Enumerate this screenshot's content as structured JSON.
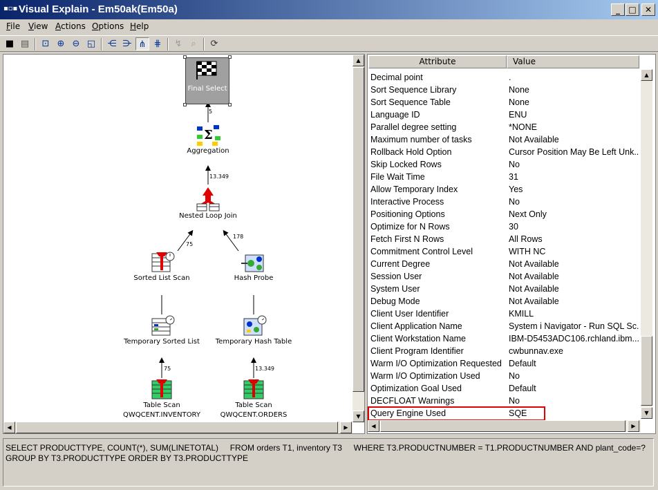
{
  "window": {
    "title": "Visual Explain - Em50ak(Em50a)",
    "icon": "graph-app-icon"
  },
  "menu": [
    {
      "key": "F",
      "rest": "ile"
    },
    {
      "key": "V",
      "rest": "iew"
    },
    {
      "key": "A",
      "rest": "ctions"
    },
    {
      "key": "O",
      "rest": "ptions"
    },
    {
      "key": "H",
      "rest": "elp"
    }
  ],
  "graph": {
    "nodes": {
      "final_select": "Final Select",
      "aggregation": "Aggregation",
      "nested_loop_join": "Nested Loop Join",
      "sorted_list_scan": "Sorted List Scan",
      "hash_probe": "Hash Probe",
      "temporary_sorted_list": "Temporary Sorted List",
      "temporary_hash_table": "Temporary Hash Table",
      "table_scan_inventory": "Table Scan",
      "table_scan_inventory_name": "QWQCENT.INVENTORY",
      "table_scan_orders": "Table Scan",
      "table_scan_orders_name": "QWQCENT.ORDERS"
    },
    "edges": {
      "agg_to_final": "5",
      "join_to_agg": "13.349",
      "sorted_to_join": "75",
      "hash_to_join": "178",
      "inv_to_tmp": "75",
      "ord_to_tmp": "13.349"
    }
  },
  "table": {
    "headers": {
      "attribute": "Attribute",
      "value": "Value"
    },
    "rows": [
      {
        "attr": "Decimal point",
        "val": "."
      },
      {
        "attr": "Sort Sequence Library",
        "val": "None"
      },
      {
        "attr": "Sort Sequence Table",
        "val": "None"
      },
      {
        "attr": "Language ID",
        "val": "ENU"
      },
      {
        "attr": "Parallel degree setting",
        "val": "*NONE"
      },
      {
        "attr": "Maximum number of tasks",
        "val": "Not Available"
      },
      {
        "attr": "Rollback Hold Option",
        "val": "Cursor Position May Be Left Unk..."
      },
      {
        "attr": "Skip Locked Rows",
        "val": "No"
      },
      {
        "attr": "File Wait Time",
        "val": "31"
      },
      {
        "attr": "Allow Temporary Index",
        "val": "Yes"
      },
      {
        "attr": "Interactive Process",
        "val": "No"
      },
      {
        "attr": "Positioning Options",
        "val": "Next Only"
      },
      {
        "attr": "Optimize for N Rows",
        "val": "30"
      },
      {
        "attr": "Fetch First N Rows",
        "val": "All Rows"
      },
      {
        "attr": "Commitment Control Level",
        "val": "WITH NC"
      },
      {
        "attr": "Current Degree",
        "val": "Not Available"
      },
      {
        "attr": "Session User",
        "val": "Not Available"
      },
      {
        "attr": "System User",
        "val": "Not Available"
      },
      {
        "attr": "Debug Mode",
        "val": "Not Available"
      },
      {
        "attr": "Client User Identifier",
        "val": "KMILL"
      },
      {
        "attr": "Client Application Name",
        "val": "System i Navigator - Run SQL Sc..."
      },
      {
        "attr": "Client Workstation Name",
        "val": "IBM-D5453ADC106.rchland.ibm...."
      },
      {
        "attr": "Client Program Identifier",
        "val": "cwbunnav.exe"
      },
      {
        "attr": "Warm I/O Optimization Requested",
        "val": "Default"
      },
      {
        "attr": "Warm I/O Optimization Used",
        "val": "No"
      },
      {
        "attr": "Optimization Goal Used",
        "val": "Default"
      },
      {
        "attr": "DECFLOAT Warnings",
        "val": "No"
      },
      {
        "attr": "Query Engine Used",
        "val": "SQE"
      }
    ]
  },
  "sql": {
    "line1": "SELECT PRODUCTTYPE, COUNT(*), SUM(LINETOTAL)     FROM orders T1, inventory T3     WHERE T3.PRODUCTNUMBER = T1.PRODUCTNUMBER AND plant_code=?",
    "line2": "GROUP BY T3.PRODUCTTYPE ORDER BY T3.PRODUCTTYPE"
  },
  "colors": {
    "title_start": "#0a246a",
    "title_end": "#a6caf0",
    "highlight": "#e00000"
  }
}
